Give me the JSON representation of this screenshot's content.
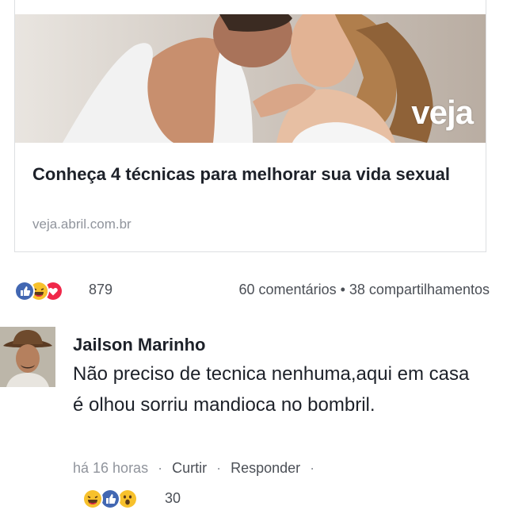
{
  "post_card": {
    "image_alt": "Casal se beijando",
    "logo_text": "veja",
    "title": "Conheça 4 técnicas para melhorar sua vida sexual",
    "domain": "veja.abril.com.br"
  },
  "post_stats": {
    "reaction_icons": [
      "like-icon",
      "haha-icon",
      "love-icon"
    ],
    "reaction_count": "879",
    "comments": "60 comentários",
    "separator": "•",
    "shares": "38 compartilhamentos"
  },
  "comment": {
    "author": "Jailson Marinho",
    "text": "Não preciso de tecnica nenhuma,aqui em casa é olhou sorriu mandioca no bombril.",
    "time": "há 16 horas",
    "separator": "·",
    "like_label": "Curtir",
    "reply_label": "Responder",
    "reaction_icons": [
      "haha-icon",
      "like-icon",
      "wow-icon"
    ],
    "reaction_count": "30"
  },
  "colors": {
    "like_blue": "#4267b2",
    "love_red": "#f0284a",
    "emoji_yellow": "#f7c12c",
    "secondary_text": "#90949c",
    "primary_text": "#1d2129"
  }
}
